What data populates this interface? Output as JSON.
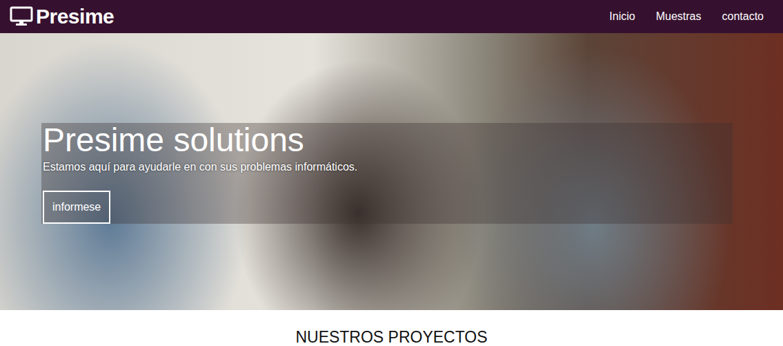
{
  "brand": {
    "name": "Presime"
  },
  "nav": [
    {
      "label": "Inicio",
      "selected": false
    },
    {
      "label": "Muestras",
      "selected": false
    },
    {
      "label": "contacto",
      "selected": false
    }
  ],
  "hero": {
    "title": "Presime solutions",
    "subtitle": "Estamos aquí para ayudarle en con sus problemas informáticos.",
    "button": "informese"
  },
  "section": {
    "title": "NUESTROS PROYECTOS"
  }
}
